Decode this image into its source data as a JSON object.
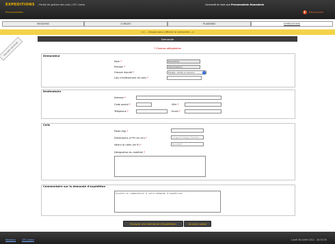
{
  "header": {
    "brand": "EXPEDITIONS",
    "brand_sub": "- Portail de gestion des colis | LPC Castro",
    "subtitle": "Personnalisation",
    "connected_prefix": "Connecté en tant que",
    "user_name": "Prenomadmin Nomadmin",
    "logout_label": "Déconnexion"
  },
  "tabs": [
    {
      "label": "MISSIONS"
    },
    {
      "label": "CONGES"
    },
    {
      "label": "PLANNING"
    },
    {
      "label": "EXPEDITIONS"
    }
  ],
  "search_toggle": "<< -- Cliquez pour afficher la recherche -->",
  "side_ribbon": "Nouvelle demande",
  "page_title": "Demande",
  "required_note": "* Champs obligatoires",
  "demandeur": {
    "title": "Demandeur",
    "nom_label": "Nom",
    "nom_value": "Nomadmin",
    "prenom_label": "Prénom",
    "prenom_value": "Prenomadmin",
    "groupe_label": "Groupe imputé",
    "groupe_value": "Equipe, centre ou service",
    "lieu_label": "Lieu d'enlèvement du colis",
    "lieu_value": ""
  },
  "destinataire": {
    "title": "Destinataire",
    "adresse_label": "Adresse",
    "code_postal_label": "Code postal",
    "ville_label": "Ville",
    "telephone_label": "Téléphone",
    "email_label": "Email"
  },
  "colis": {
    "title": "Colis",
    "poids_label": "Poids (kg)",
    "dimensions_label": "Dimensions (L*l*h en cm)",
    "dimensions_placeholder": "Longueur*largeur*hauteur",
    "valeur_label": "Valeur du bien (en €)",
    "valeur_placeholder": "Facultatif",
    "designation_label": "Désignation du matériel"
  },
  "commentaire": {
    "title": "Commentaire sur la demande d'expédition",
    "placeholder": "Ajoutez un commentaire à votre demande d'expédition"
  },
  "buttons": {
    "submit": "Envoyer une demande d'expédition",
    "cancel": "Annuler saisie"
  },
  "footer": {
    "links": [
      "Mentions",
      "LPC Castro"
    ],
    "date": "Lundi 30 juillet 2012 - 10:33:35"
  },
  "colors": {
    "accent": "#f0b400",
    "header_bg": "#2a2a2a",
    "search_bar": "#f4d34a",
    "required": "#cc0000"
  }
}
